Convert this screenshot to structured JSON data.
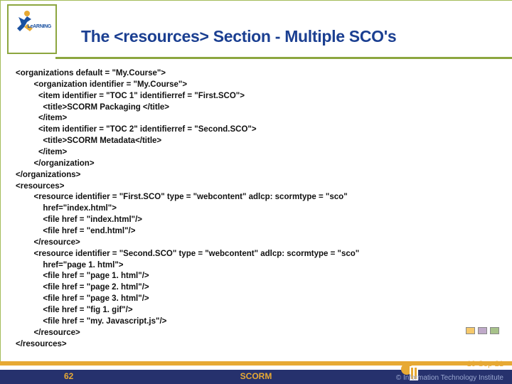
{
  "logo": {
    "label": "LeARNING"
  },
  "title": "The <resources> Section - Multiple SCO's",
  "code": "<organizations default = \"My.Course\">\n        <organization identifier = \"My.Course\">\n          <item identifier = \"TOC 1\" identifierref = \"First.SCO\">\n            <title>SCORM Packaging </title>\n          </item>\n          <item identifier = \"TOC 2\" identifierref = \"Second.SCO\">\n            <title>SCORM Metadata</title>\n          </item>\n        </organization>\n</organizations>\n<resources>\n        <resource identifier = \"First.SCO\" type = \"webcontent\" adlcp: scormtype = \"sco\"\n            href=\"index.html\">\n            <file href = \"index.html\"/>\n            <file href = \"end.html\"/>\n        </resource>\n        <resource identifier = \"Second.SCO\" type = \"webcontent\" adlcp: scormtype = \"sco\"\n            href=\"page 1. html\">\n            <file href = \"page 1. html\"/>\n            <file href = \"page 2. html\"/>\n            <file href = \"page 3. html\"/>\n            <file href = \"fig 1. gif\"/>\n            <file href = \"my. Javascript.js\"/>\n        </resource>\n</resources>",
  "footer": {
    "page": "62",
    "center": "SCORM",
    "date": "10-Sep-21",
    "copyright": "© Information Technology Institute"
  },
  "chips": [
    "#f6c96b",
    "#bfa9c9",
    "#a7c28a"
  ]
}
